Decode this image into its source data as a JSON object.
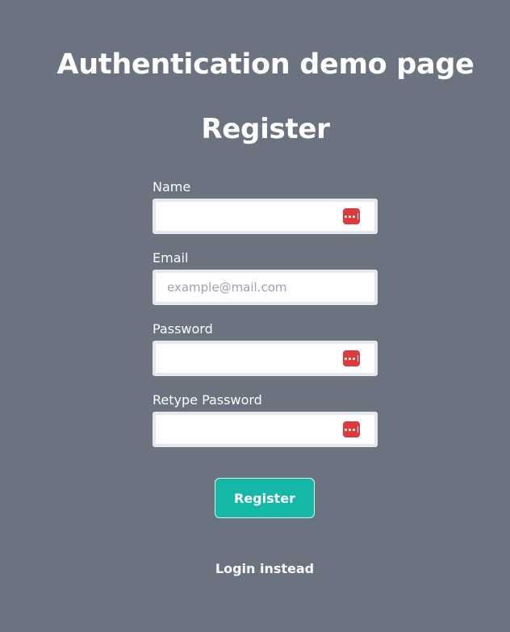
{
  "app_title": "Authentication demo page",
  "page_title": "Register",
  "form": {
    "fields": [
      {
        "label": "Name",
        "value": "",
        "placeholder": "",
        "password_manager_icon": "password-manager-icon"
      },
      {
        "label": "Email",
        "value": "",
        "placeholder": "example@mail.com"
      },
      {
        "label": "Password",
        "value": "",
        "placeholder": "",
        "password_manager_icon": "password-manager-icon"
      },
      {
        "label": "Retype Password",
        "value": "",
        "placeholder": "",
        "password_manager_icon": "password-manager-icon"
      }
    ],
    "submit_label": "Register"
  },
  "login_link_label": "Login instead",
  "colors": {
    "background": "#6b7280",
    "accent": "#14b8a6",
    "password_manager_icon": "#dc3b3b"
  }
}
